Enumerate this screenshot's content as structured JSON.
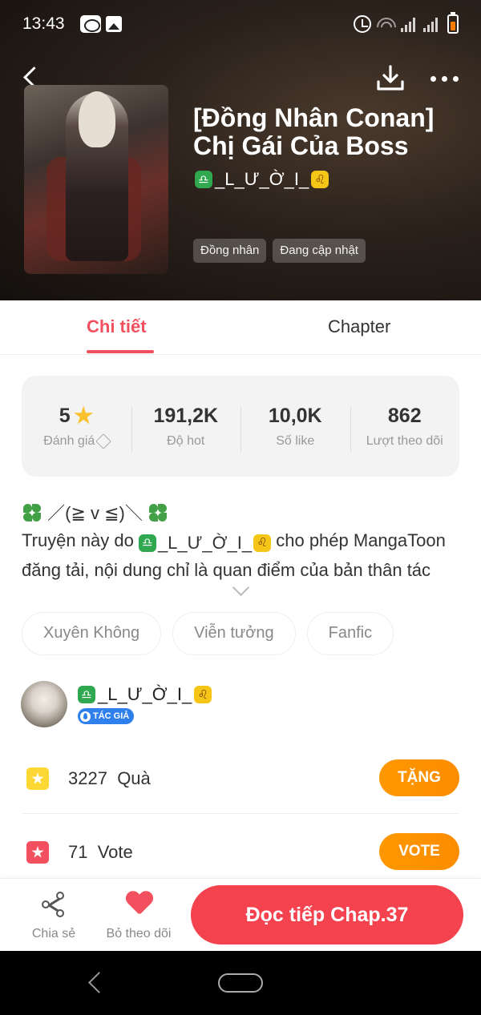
{
  "status_bar": {
    "time": "13:43"
  },
  "book": {
    "title": "[Đồng Nhân Conan] Chị Gái Của Boss",
    "author": "_L_Ư_Ờ_I_",
    "author_sign_left": "♎",
    "author_sign_right": "♌",
    "tags": [
      "Đồng nhân",
      "Đang cập nhật"
    ]
  },
  "tabs": {
    "detail": "Chi tiết",
    "chapter": "Chapter"
  },
  "stats": [
    {
      "value": "5",
      "label": "Đánh giá"
    },
    {
      "value": "191,2K",
      "label": "Độ hot"
    },
    {
      "value": "10,0K",
      "label": "Số like"
    },
    {
      "value": "862",
      "label": "Lượt theo dõi"
    }
  ],
  "description": {
    "line1_text": "／(≧ v ≦)＼",
    "line2_prefix": "Truyện này do ",
    "line2_suffix": " cho phép MangaToon",
    "line3": "đăng tải, nội dung chỉ là quan điểm của bản thân tác"
  },
  "genres": [
    "Xuyên Không",
    "Viễn tưởng",
    "Fanfic"
  ],
  "author_card": {
    "name": "_L_Ư_Ờ_I_",
    "badge": "TÁC GIẢ"
  },
  "gift": {
    "count": "3227",
    "label": "Quà",
    "button": "TẶNG"
  },
  "vote": {
    "count": "71",
    "label": "Vote",
    "button": "VOTE"
  },
  "actions": {
    "share": "Chia sẻ",
    "unfollow": "Bỏ theo dõi",
    "read": "Đọc tiếp Chap.37"
  },
  "colors": {
    "accent": "#f2505e",
    "orange": "#fb8c00",
    "stars": "#fbc02d"
  }
}
